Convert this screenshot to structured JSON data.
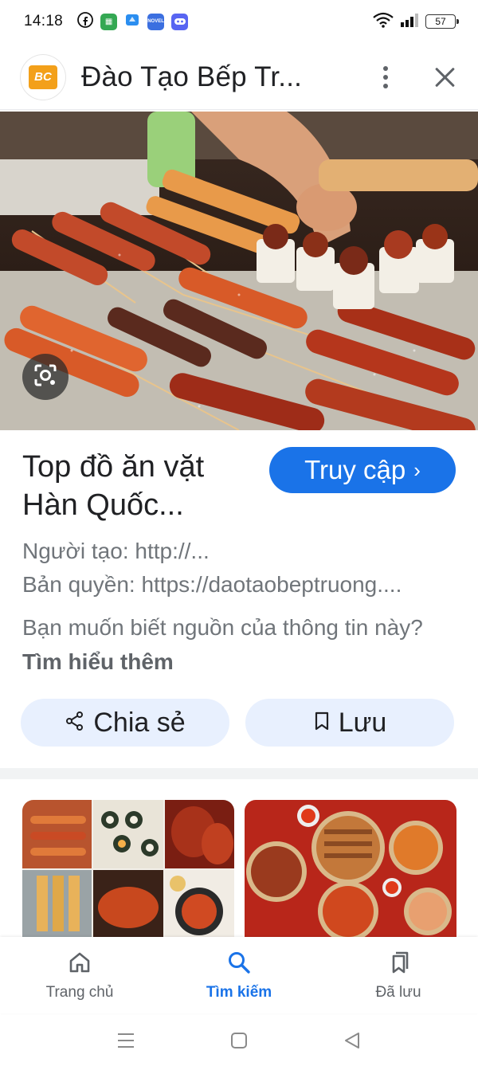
{
  "status_bar": {
    "time": "14:18",
    "battery": "57",
    "icons": [
      "facebook-icon",
      "app-green-icon",
      "app-blue-icon",
      "noveltoon-icon",
      "discord-icon",
      "wifi-icon",
      "signal-icon",
      "battery-icon"
    ]
  },
  "header": {
    "site_name": "Đào Tạo Bếp Tr...",
    "site_logo_text": "BC"
  },
  "result": {
    "title_line1": "Top đồ ăn vặt",
    "title_line2": "Hàn Quốc...",
    "visit_label": "Truy cập",
    "visit_chevron": "›",
    "creator": "Người tạo: http://...",
    "copyright": "Bản quyền: https://daotaobeptruong....",
    "question": "Bạn muốn biết nguồn của thông tin này?",
    "learn_more": "Tìm hiểu thêm"
  },
  "actions": {
    "share_label": "Chia sẻ",
    "save_label": "Lưu"
  },
  "bottom_nav": {
    "items": [
      {
        "label": "Trang chủ",
        "icon": "home-icon",
        "active": false
      },
      {
        "label": "Tìm kiếm",
        "icon": "search-icon",
        "active": true
      },
      {
        "label": "Đã lưu",
        "icon": "saved-icon",
        "active": false
      }
    ]
  },
  "colors": {
    "accent": "#1a73e8",
    "pill_bg": "#e8f0fe",
    "muted_text": "#70757a"
  }
}
